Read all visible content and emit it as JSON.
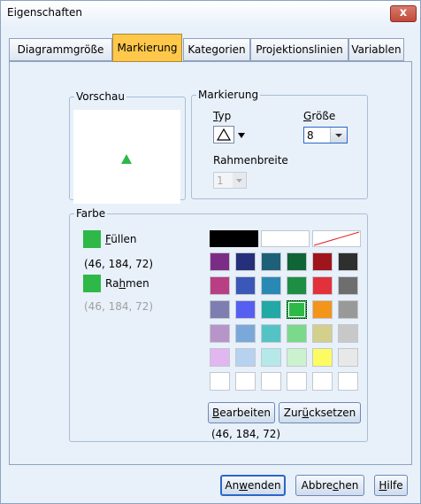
{
  "window": {
    "title": "Eigenschaften",
    "close_glyph": "x"
  },
  "tabs": [
    {
      "label": "Diagrammgröße",
      "active": false
    },
    {
      "label": "Markierung",
      "active": true
    },
    {
      "label": "Kategorien",
      "active": false
    },
    {
      "label": "Projektionslinien",
      "active": false
    },
    {
      "label": "Variablen",
      "active": false
    }
  ],
  "preview": {
    "legend": "Vorschau",
    "marker_color": "#2eb848"
  },
  "marker": {
    "legend": "Markierung",
    "type_label": "Typ",
    "type_mnemonic": "T",
    "type_rest": "yp",
    "size_label": "Größe",
    "size_mnemonic": "G",
    "size_rest": "röße",
    "size_value": "8",
    "border_width_label": "Rahmenbreite",
    "border_width_value": "1"
  },
  "color": {
    "legend": "Farbe",
    "fill_pre": "",
    "fill_mnemonic": "F",
    "fill_rest": "üllen",
    "fill_rgb": "(46, 184, 72)",
    "border_pre": "Ra",
    "border_mnemonic": "h",
    "border_rest": "men",
    "border_rgb": "(46, 184, 72)",
    "swatch_color": "#2eb848",
    "selected_rgb": "(46, 184, 72)",
    "edit_button": {
      "pre": "",
      "mn": "B",
      "post": "earbeiten"
    },
    "reset_button": {
      "pre": "Zur",
      "mn": "ü",
      "post": "cksetzen"
    },
    "palette": [
      [
        "#7b2d86",
        "#262f7a",
        "#1f6079",
        "#106436",
        "#a0141b",
        "#2f2f2f"
      ],
      [
        "#b83f83",
        "#3a58b7",
        "#2a89b4",
        "#1e8e44",
        "#e2313a",
        "#6e6e6e"
      ],
      [
        "#7e7fb0",
        "#5560f0",
        "#22a8a5",
        "#2eb848",
        "#f3941b",
        "#999999"
      ],
      [
        "#b795c8",
        "#7aa8d8",
        "#55c3c6",
        "#7ad98b",
        "#d3cf8c",
        "#c8c8c8"
      ],
      [
        "#e2b6ef",
        "#b6d2ef",
        "#b5e9e9",
        "#cbf2cf",
        "#fcfc62",
        "#e8e8e8"
      ],
      [
        "#ffffff",
        "#ffffff",
        "#ffffff",
        "#ffffff",
        "#ffffff",
        "#ffffff"
      ]
    ]
  },
  "buttons": {
    "apply": {
      "pre": "An",
      "mn": "w",
      "post": "enden"
    },
    "cancel": {
      "pre": "Abbre",
      "mn": "c",
      "post": "hen"
    },
    "help": {
      "pre": "",
      "mn": "H",
      "post": "ilfe"
    }
  }
}
